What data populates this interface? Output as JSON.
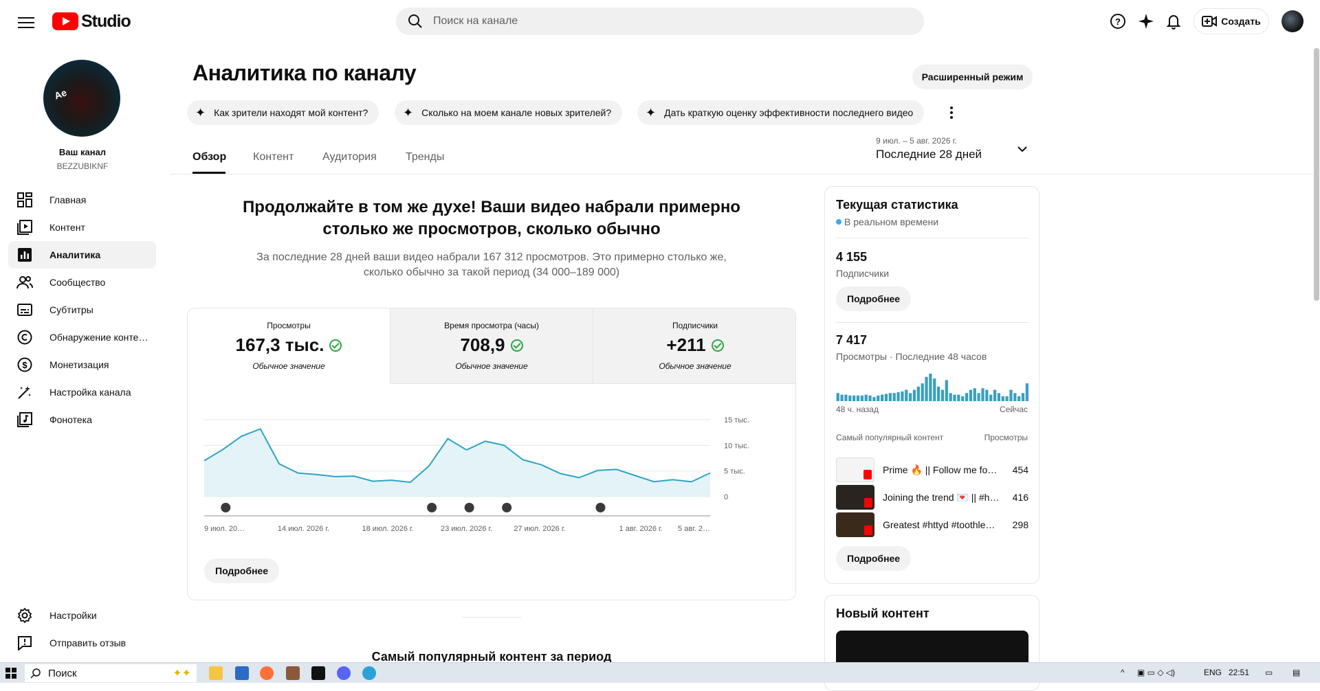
{
  "topbar": {
    "studio_label": "Studio",
    "search_placeholder": "Поиск на канале",
    "create_label": "Создать"
  },
  "sidebar": {
    "channel_name": "Ваш канал",
    "channel_handle": "BEZZUBIKNF",
    "avatar_text": "Ae",
    "items": [
      {
        "label": "Главная",
        "icon": "dashboard-icon"
      },
      {
        "label": "Контент",
        "icon": "content-icon"
      },
      {
        "label": "Аналитика",
        "icon": "analytics-icon",
        "active": true
      },
      {
        "label": "Сообщество",
        "icon": "community-icon"
      },
      {
        "label": "Субтитры",
        "icon": "subtitles-icon"
      },
      {
        "label": "Обнаружение контен…",
        "icon": "copyright-icon"
      },
      {
        "label": "Монетизация",
        "icon": "monetization-icon"
      },
      {
        "label": "Настройка канала",
        "icon": "customization-icon"
      },
      {
        "label": "Фонотека",
        "icon": "audio-library-icon"
      }
    ],
    "bottom_items": [
      {
        "label": "Настройки",
        "icon": "settings-icon"
      },
      {
        "label": "Отправить отзыв",
        "icon": "feedback-icon"
      }
    ]
  },
  "main": {
    "title": "Аналитика по каналу",
    "advanced_mode_label": "Расширенный режим",
    "chips": [
      "Как зрители находят мой контент?",
      "Сколько на моем канале новых зрителей?",
      "Дать краткую оценку эффективности последнего видео"
    ],
    "tabs": [
      "Обзор",
      "Контент",
      "Аудитория",
      "Тренды"
    ],
    "date_range": {
      "dates": "9 июл. – 5 авг. 2026 г.",
      "label": "Последние 28 дней"
    },
    "headline": "Продолжайте в том же духе! Ваши видео набрали примерно столько же просмотров, сколько обычно",
    "subheadline": "За последние 28 дней ваши видео набрали 167 312 просмотров. Это примерно столько же, сколько обычно за такой период (34 000–189 000)",
    "metrics": [
      {
        "title": "Просмотры",
        "value": "167,3 тыс.",
        "note": "Обычное значение"
      },
      {
        "title": "Время просмотра (часы)",
        "value": "708,9",
        "note": "Обычное значение"
      },
      {
        "title": "Подписчики",
        "value": "+211",
        "note": "Обычное значение"
      }
    ],
    "more_label": "Подробнее",
    "top_content_title": "Самый популярный контент за период"
  },
  "chart_data": {
    "type": "area",
    "title": "",
    "ylabel": "",
    "y_ticks": [
      "15 тыс.",
      "10 тыс.",
      "5 тыс.",
      "0"
    ],
    "ylim": [
      0,
      15000
    ],
    "x_tick_labels": [
      "9 июл. 20…",
      "14 июл. 2026 г.",
      "18 июл. 2026 г.",
      "23 июл. 2026 г.",
      "27 июл. 2026 г.",
      "1 авг. 2026 г.",
      "5 авг. 2…"
    ],
    "x": [
      "9 июл.",
      "10 июл.",
      "11 июл.",
      "12 июл.",
      "13 июл.",
      "14 июл.",
      "15 июл.",
      "16 июл.",
      "17 июл.",
      "18 июл.",
      "19 июл.",
      "20 июл.",
      "21 июл.",
      "22 июл.",
      "23 июл.",
      "24 июл.",
      "25 июл.",
      "26 июл.",
      "27 июл.",
      "28 июл.",
      "29 июл.",
      "30 июл.",
      "31 июл.",
      "1 авг.",
      "2 авг.",
      "3 авг.",
      "4 авг.",
      "5 авг."
    ],
    "values": [
      7000,
      9200,
      11800,
      13200,
      6400,
      4600,
      4300,
      3900,
      4000,
      3000,
      3200,
      2800,
      6000,
      11300,
      9100,
      10800,
      10000,
      7200,
      6200,
      4500,
      3700,
      5100,
      5300,
      4100,
      2900,
      3300,
      2900,
      4600
    ],
    "color": "#2ea3c7",
    "fill": "#e3f3f8",
    "shorts_markers_at": [
      1,
      12,
      14,
      16,
      21
    ]
  },
  "realtime": {
    "title": "Текущая статистика",
    "live_label": "В реальном времени",
    "subscribers_value": "4 155",
    "subscribers_label": "Подписчики",
    "views_value": "7 417",
    "views_label": "Просмотры · Последние 48 часов",
    "bars_start_label": "48 ч. назад",
    "bars_end_label": "Сейчас",
    "bars": [
      10,
      8,
      8,
      7,
      7,
      7,
      7,
      8,
      7,
      5,
      7,
      8,
      9,
      10,
      10,
      11,
      12,
      14,
      10,
      14,
      18,
      22,
      30,
      34,
      28,
      18,
      14,
      26,
      10,
      8,
      8,
      6,
      10,
      14,
      16,
      10,
      16,
      14,
      8,
      14,
      10,
      6,
      6,
      14,
      10,
      6,
      10,
      22
    ],
    "top_header": "Самый популярный контент",
    "top_header_metric": "Просмотры",
    "top_items": [
      {
        "title": "Prime 🔥 || Follow me for…",
        "views": "454"
      },
      {
        "title": "Joining the trend 💌 || #h…",
        "views": "416"
      },
      {
        "title": "Greatest #httyd #toothle…",
        "views": "298"
      }
    ],
    "more_label": "Подробнее",
    "new_content_title": "Новый контент"
  },
  "taskbar": {
    "search_label": "Поиск",
    "lang": "ENG",
    "time": "22:51"
  }
}
